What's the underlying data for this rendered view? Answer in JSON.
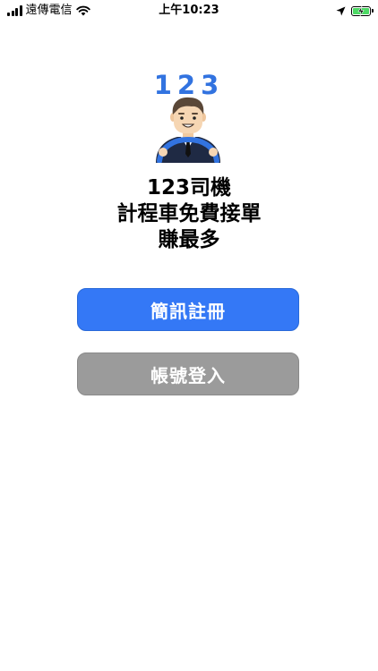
{
  "status_bar": {
    "carrier": "遠傳電信",
    "time": "上午10:23",
    "signal_icon": "signal-bars-icon",
    "wifi_icon": "wifi-icon",
    "location_icon": "location-arrow-icon",
    "battery_icon": "battery-charging-icon",
    "battery_color": "#4cd964"
  },
  "logo": {
    "digits": "123",
    "digits_color": "#3273e0",
    "illustration": "driver-at-wheel-icon"
  },
  "headline": {
    "line1": "123司機",
    "line2": "計程車免費接單",
    "line3": "賺最多"
  },
  "buttons": {
    "register_label": "簡訊註冊",
    "register_color": "#3478f6",
    "login_label": "帳號登入",
    "login_color": "#9b9b9b"
  }
}
